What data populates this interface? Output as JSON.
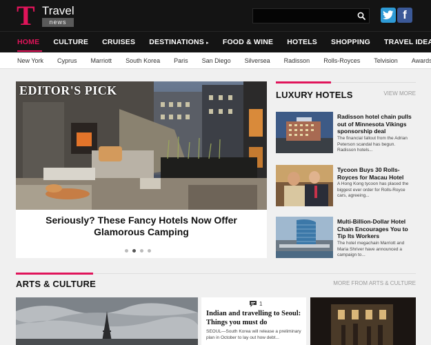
{
  "header": {
    "logo_letter": "T",
    "logo_title": "Travel",
    "logo_sub": "news",
    "search_placeholder": "",
    "social": [
      "twitter",
      "facebook"
    ],
    "facebook_glyph": "f"
  },
  "nav": {
    "items": [
      "HOME",
      "CULTURE",
      "CRUISES",
      "DESTINATIONS",
      "FOOD & WINE",
      "HOTELS",
      "SHOPPING",
      "TRAVEL IDEAS"
    ],
    "active": "HOME",
    "dropdown_marker": "▸"
  },
  "subnav": {
    "items": [
      "New York",
      "Cyprus",
      "Marriott",
      "South Korea",
      "Paris",
      "San Diego",
      "Silversea",
      "Radisson",
      "Rolls-Royces",
      "Telvision",
      "Awards"
    ]
  },
  "hero": {
    "badge": "EDITOR'S PICK",
    "title": "Seriously? These Fancy Hotels Now Offer Glamorous Camping",
    "slides_total": 4,
    "slide_active": 2
  },
  "luxury": {
    "title": "LUXURY HOTELS",
    "more": "VIEW MORE",
    "items": [
      {
        "headline": "Radisson hotel chain pulls out of Minnesota Vikings sponsorship deal",
        "desc": "The financial fallout from the Adrian Peterson scandal has begun. Radisson hotels..."
      },
      {
        "headline": "Tycoon Buys 30 Rolls-Royces for Macau Hotel",
        "desc": "A Hong Kong tycoon has placed the biggest ever order for Rolls-Royce cars, agreeing..."
      },
      {
        "headline": "Multi-Billion-Dollar Hotel Chain Encourages You to Tip Its Workers",
        "desc": "The hotel megachain Marriott and Maria Shriver have announced a campaign to..."
      }
    ]
  },
  "arts": {
    "title": "ARTS & CULTURE",
    "more": "MORE FROM ARTS & CULTURE",
    "card": {
      "comments": "1",
      "title": "Indian and travelling to Seoul: Things you must do",
      "desc": "SEOUL—South Korea will release a preliminary plan in October to lay out how debt..."
    }
  },
  "colors": {
    "accent": "#e0145a",
    "header_bg": "#141414",
    "twitter": "#2e9bd6",
    "facebook": "#3b5998"
  }
}
